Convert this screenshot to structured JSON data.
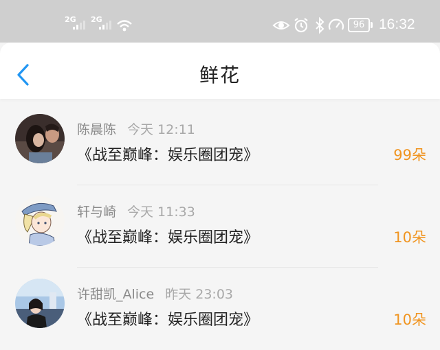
{
  "status_bar": {
    "signal_1": "2G",
    "signal_2": "2G",
    "icons": [
      "wifi-icon",
      "eye-icon",
      "alarm-icon",
      "bluetooth-icon",
      "speed-icon"
    ],
    "battery": "96",
    "time": "16:32"
  },
  "header": {
    "title": "鲜花",
    "back_icon": "chevron-left-icon",
    "accent": "#2196f3"
  },
  "items": [
    {
      "name": "陈晨陈",
      "time": "今天 12:11",
      "book": "《战至巅峰：娱乐圈团宠》",
      "count": "99朵"
    },
    {
      "name": "轩与崎",
      "time": "今天 11:33",
      "book": "《战至巅峰：娱乐圈团宠》",
      "count": "10朵"
    },
    {
      "name": "许甜凯_Alice",
      "time": "昨天 23:03",
      "book": "《战至巅峰：娱乐圈团宠》",
      "count": "10朵"
    }
  ],
  "colors": {
    "count": "#f0941f",
    "status_bar": "#cfcfcf"
  }
}
